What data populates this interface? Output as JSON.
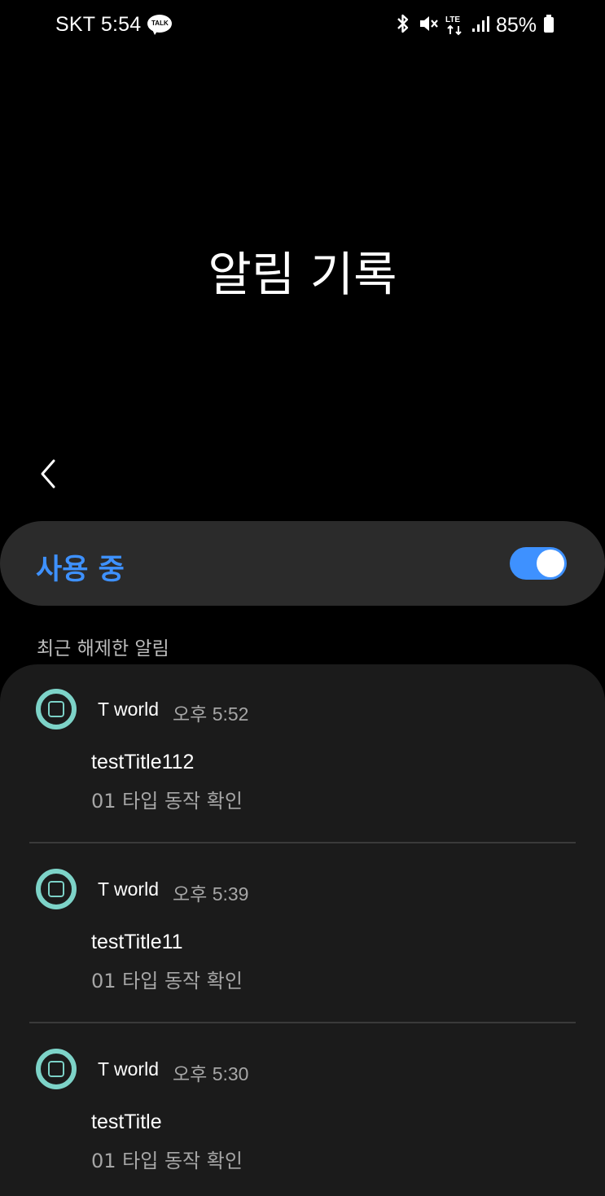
{
  "status_bar": {
    "carrier_time": "SKT 5:54",
    "talk_badge": "TALK",
    "network": "LTE",
    "battery": "85%",
    "icons": [
      "bluetooth-icon",
      "mute-icon",
      "lte-icon",
      "signal-icon",
      "battery-icon"
    ]
  },
  "header": {
    "title": "알림 기록"
  },
  "master_switch": {
    "label": "사용 중",
    "enabled": true,
    "accent": "#3e91ff"
  },
  "section": {
    "title": "최근 해제한 알림"
  },
  "notifications": [
    {
      "app": "T world",
      "time": "오후 5:52",
      "title": "testTitle112",
      "body": "01 타입 동작 확인"
    },
    {
      "app": "T world",
      "time": "오후 5:39",
      "title": "testTitle11",
      "body": "01 타입 동작 확인"
    },
    {
      "app": "T world",
      "time": "오후 5:30",
      "title": "testTitle",
      "body": "01 타입 동작 확인"
    }
  ],
  "colors": {
    "background": "#000000",
    "card": "#1b1b1b",
    "switch_bar": "#2b2b2b",
    "app_icon": "#7dd3c8"
  }
}
